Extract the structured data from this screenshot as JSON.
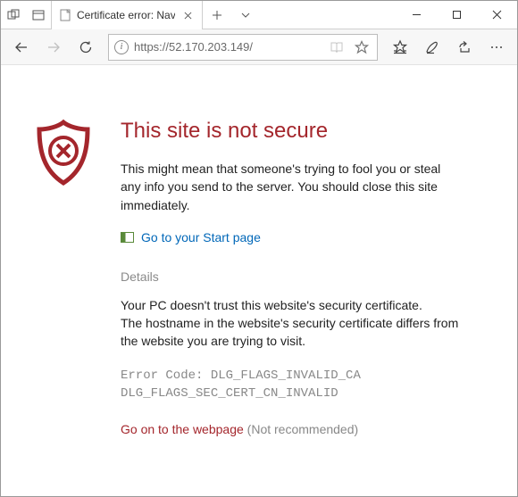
{
  "window": {
    "tab_title": "Certificate error: Naviga",
    "url": "https://52.170.203.149/"
  },
  "page": {
    "heading": "This site is not secure",
    "warning_text": "This might mean that someone's trying to fool you or steal any info you send to the server. You should close this site immediately.",
    "start_link_label": "Go to your Start page",
    "details_label": "Details",
    "details_line1": "Your PC doesn't trust this website's security certificate.",
    "details_line2": "The hostname in the website's security certificate differs from the website you are trying to visit.",
    "error_code_prefix": "Error Code: ",
    "error_code_1": "DLG_FLAGS_INVALID_CA",
    "error_code_2": "DLG_FLAGS_SEC_CERT_CN_INVALID",
    "go_on_label": "Go on to the webpage",
    "go_on_note": " (Not recommended)"
  }
}
